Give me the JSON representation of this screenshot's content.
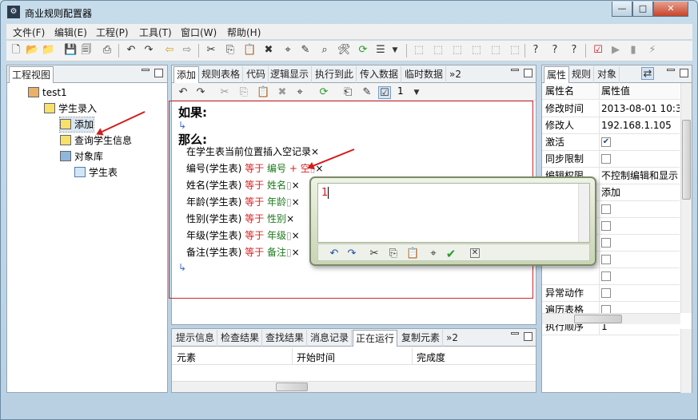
{
  "window": {
    "title": "商业规则配置器",
    "app_icon": "gear-icon",
    "btn_min": "—",
    "btn_max": "□",
    "btn_close": "✕"
  },
  "menu": [
    "文件(F)",
    "编辑(E)",
    "工程(P)",
    "工具(T)",
    "窗口(W)",
    "帮助(H)"
  ],
  "toolbar": {
    "dropdown_value": "1"
  },
  "project_view": {
    "tab": "工程视图",
    "items": [
      {
        "label": "test1",
        "icon": "project-icon"
      },
      {
        "label": "学生录入",
        "icon": "folder-icon"
      },
      {
        "label": "添加",
        "icon": "rule-icon"
      },
      {
        "label": "查询学生信息",
        "icon": "rule-icon"
      },
      {
        "label": "对象库",
        "icon": "database-icon"
      },
      {
        "label": "学生表",
        "icon": "table-icon"
      }
    ]
  },
  "editor": {
    "tabs": [
      "添加",
      "规则表格",
      "代码",
      "逻辑显示",
      "执行到此",
      "传入数据",
      "临时数据"
    ],
    "overflow": "»2",
    "line_no": "1",
    "if_label": "如果:",
    "then_label": "那么:",
    "first_line": "在学生表当前位置插入空记录",
    "lines": [
      {
        "field": "编号(学生表)",
        "op": "等于",
        "value": "编号",
        "extra": "+",
        "extra_val": "空"
      },
      {
        "field": "姓名(学生表)",
        "op": "等于",
        "value": "姓名"
      },
      {
        "field": "年龄(学生表)",
        "op": "等于",
        "value": "年龄"
      },
      {
        "field": "性别(学生表)",
        "op": "等于",
        "value": "性别"
      },
      {
        "field": "年级(学生表)",
        "op": "等于",
        "value": "年级"
      },
      {
        "field": "备注(学生表)",
        "op": "等于",
        "value": "备注"
      }
    ]
  },
  "popup": {
    "input_value": "1"
  },
  "properties": {
    "tabs": [
      "属性",
      "规则",
      "对象"
    ],
    "col_name": "属性名",
    "col_value": "属性值",
    "rows": [
      {
        "name": "修改时间",
        "value": "2013-08-01 10:3"
      },
      {
        "name": "修改人",
        "value": "192.168.1.105"
      },
      {
        "name": "激活",
        "checked": true
      },
      {
        "name": "同步限制",
        "checked": false
      },
      {
        "name": "编辑权限",
        "value": "不控制编辑和显示"
      },
      {
        "name": "",
        "value": "添加"
      },
      {
        "name": "",
        "checked": false
      },
      {
        "name": "",
        "checked": false
      },
      {
        "name": "",
        "checked": false
      },
      {
        "name": "",
        "checked": false
      },
      {
        "name": "",
        "checked": false
      },
      {
        "name": "异常动作",
        "checked": false
      },
      {
        "name": "遍历表格",
        "checked": false
      },
      {
        "name": "执行顺序",
        "value": "1"
      }
    ]
  },
  "bottom": {
    "tabs": [
      "提示信息",
      "检查结果",
      "查找结果",
      "消息记录",
      "正在运行",
      "复制元素"
    ],
    "overflow": "»2",
    "columns": [
      "元素",
      "开始时间",
      "完成度"
    ]
  }
}
